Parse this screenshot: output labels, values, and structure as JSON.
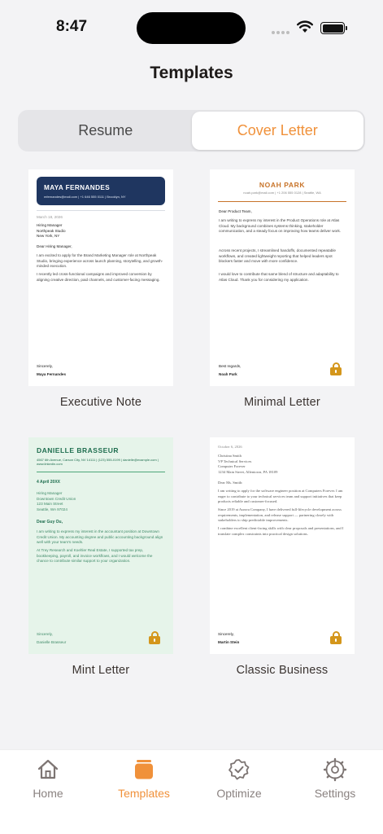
{
  "status_bar": {
    "time": "8:47"
  },
  "header": {
    "title": "Templates"
  },
  "segmented": {
    "resume": "Resume",
    "cover_letter": "Cover Letter",
    "selected": "Cover Letter"
  },
  "accent_color": "#f0913a",
  "templates": [
    {
      "label": "Executive Note",
      "locked": false,
      "preview": {
        "name": "MAYA FERNANDES",
        "contact": "mfernandes@mail.com  |  +1 646 555 0111  |  Brooklyn, NY",
        "date": "March 18, 2026",
        "recipient": [
          "Hiring Manager",
          "Northpeak Studio",
          "New York, NY"
        ],
        "greeting": "Dear Hiring Manager,",
        "p1": "I am excited to apply for the Brand Marketing Manager role at Northpeak Studio, bringing experience across launch planning, storytelling, and growth-minded execution.",
        "p2": "I recently led cross-functional campaigns and improved conversion by aligning creative direction, paid channels, and customer-facing messaging.",
        "closing": "Sincerely,",
        "signature": "Maya Fernandes"
      }
    },
    {
      "label": "Minimal Letter",
      "locked": true,
      "preview": {
        "name": "NOAH PARK",
        "contact": "noah.park@mail.com  |  +1 206 555 0128  |  Seattle, WA",
        "greeting": "Dear Product Team,",
        "p1": "I am writing to express my interest in the Product Operations role at Atlas Cloud. My background combines systems thinking, stakeholder communication, and a steady focus on improving how teams deliver work.",
        "p2": "Across recent projects, I streamlined handoffs, documented repeatable workflows, and created lightweight reporting that helped leaders spot blockers faster and move with more confidence.",
        "p3": "I would love to contribute that same blend of structure and adaptability to Atlas Cloud. Thank you for considering my application.",
        "closing": "Best regards,",
        "signature": "Noah Park"
      }
    },
    {
      "label": "Mint Letter",
      "locked": true,
      "preview": {
        "name": "DANIELLE BRASSEUR",
        "contact": "4567 6th Avenue, Carson City, NV 14111  |  (123) 555-0199  |  danielle@example.com  |  www.linkedin.com",
        "date": "4 April 20XX",
        "recipient": [
          "Hiring Manager",
          "Downtown Credit Union",
          "123 Main Street",
          "Seattle, WA 97024"
        ],
        "greeting": "Dear Guy Ou,",
        "p1": "I am writing to express my interest in the accountant position at Downtown Credit Union. My accounting degree and public accounting background align well with your team's needs.",
        "p2": "At Trey Research and Koehler Real Estate, I supported tax prep, bookkeeping, payroll, and invoice workflows, and I would welcome the chance to contribute similar support to your organization.",
        "closing": "Sincerely,",
        "signature": "Danielle Brasseur"
      }
    },
    {
      "label": "Classic Business",
      "locked": true,
      "preview": {
        "date": "October 6, 2026",
        "recipient": [
          "Christina Smith",
          "VP Technical Services",
          "Computer Forever",
          "1234 Main Street, Allentown, PA 18109"
        ],
        "greeting": "Dear Ms. Smith:",
        "p1": "I am writing to apply for the software engineer position at Computers Forever. I am eager to contribute to your technical services team and support initiatives that keep products reliable and customer-focused.",
        "p2": "Since 2019 at Aurora Company, I have delivered full-lifecycle development across requirements, implementation, and release support — partnering closely with stakeholders to ship predictable improvements.",
        "p3": "I combine excellent client-facing skills with clear proposals and presentations, and I translate complex constraints into practical design solutions.",
        "closing": "Sincerely,",
        "signature": "Martin Stein"
      }
    }
  ],
  "tab_bar": [
    {
      "label": "Home",
      "icon": "home-icon",
      "active": false
    },
    {
      "label": "Templates",
      "icon": "templates-icon",
      "active": true
    },
    {
      "label": "Optimize",
      "icon": "badge-check-icon",
      "active": false
    },
    {
      "label": "Settings",
      "icon": "gear-icon",
      "active": false
    }
  ]
}
